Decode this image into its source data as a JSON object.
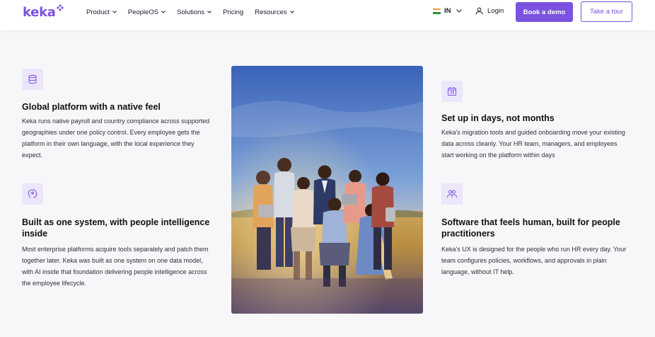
{
  "header": {
    "logo": "keka",
    "nav": [
      {
        "label": "Product",
        "has_dropdown": true
      },
      {
        "label": "PeopleOS",
        "has_dropdown": true
      },
      {
        "label": "Solutions",
        "has_dropdown": true
      },
      {
        "label": "Pricing",
        "has_dropdown": false
      },
      {
        "label": "Resources",
        "has_dropdown": true
      }
    ],
    "locale": "IN",
    "login": "Login",
    "demo_button": "Book a demo",
    "tour_button": "Take a tour"
  },
  "colors": {
    "brand": "#7b52e0",
    "icon_bg": "#ece6fb",
    "page_bg": "#f7f7f9"
  },
  "features": [
    {
      "icon": "database-icon",
      "title": "Global platform with a native feel",
      "body": "Keka runs native payroll and country compliance across supported geographies under one policy control. Every employee gets the platform in their own language, with the local experience they expect."
    },
    {
      "icon": "brain-head-icon",
      "title": "Built as one system, with people intelligence inside",
      "body": "Most enterprise platforms acquire tools separately and patch them together later. Keka was built as one system on one data model, with AI inside that foundation delivering people intelligence across the employee lifecycle."
    },
    {
      "icon": "calendar-icon",
      "title": "Set up in days, not months",
      "body": "Keka's migration tools and guided onboarding move your existing data across cleanly. Your HR team, managers, and employees start working on the platform within days"
    },
    {
      "icon": "people-group-icon",
      "title": "Software that feels human, built for people practitioners",
      "body": "Keka's UX is designed for the people who run HR every day. Your team configures policies, workflows, and approvals in plain language, without IT help."
    }
  ]
}
